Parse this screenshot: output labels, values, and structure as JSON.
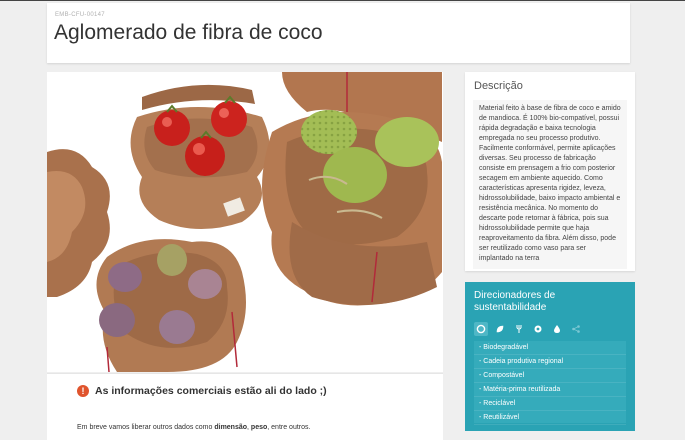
{
  "header": {
    "code": "EMB-CFU-00147",
    "title": "Aglomerado de fibra de coco"
  },
  "photo": {
    "alt": "Embalagens de fibra de coco com tomates, pinhas e figos"
  },
  "info": {
    "alert_text": "As informações comerciais estão ali do lado ;)",
    "line_prefix": "Em breve vamos liberar outros dados como ",
    "bold1": "dimensão",
    "sep": ", ",
    "bold2": "peso",
    "line_suffix": ", entre outros."
  },
  "description": {
    "title": "Descrição",
    "text": "Material feito à base de fibra de coco e amido de mandioca. É 100% bio-compatível, possui rápida degradação e baixa tecnologia empregada no seu processo produtivo. Facilmente conformável, permite aplicações diversas. Seu processo de fabricação consiste em prensagem a frio com posterior secagem em ambiente aquecido. Como características apresenta rigidez, leveza, hidrossolubilidade, baixo impacto ambiental e resistência mecânica. No momento do descarte pode retornar à fábrica, pois sua hidrossolubilidade permite que haja reaproveitamento da fibra. Além disso, pode ser reutilizado como vaso para ser implantado na terra"
  },
  "sustainability": {
    "title": "Direcionadores de sustentabilidade",
    "icons": [
      "circle-icon",
      "leaf-icon",
      "fork-icon",
      "recycle-icon",
      "drop-icon",
      "share-icon"
    ],
    "items": [
      "- Biodegradável",
      "- Cadeia produtiva regional",
      "- Compostável",
      "- Matéria-prima reutilizada",
      "- Reciclável",
      "- Reutilizável"
    ]
  },
  "colors": {
    "accent": "#2aa3b4",
    "alert": "#e0542d"
  }
}
